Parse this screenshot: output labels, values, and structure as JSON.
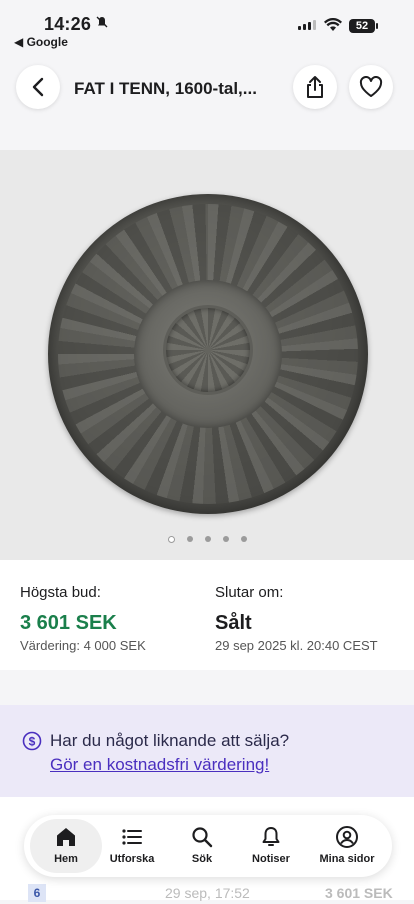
{
  "status_bar": {
    "time": "14:26",
    "back_app": "◀ Google",
    "battery": "52"
  },
  "header": {
    "title": "FAT I TENN, 1600-tal,..."
  },
  "gallery": {
    "image_count": 5,
    "active_index": 0
  },
  "bid": {
    "highest_bid_label": "Högsta bud:",
    "highest_bid_value": "3 601 SEK",
    "valuation": "Värdering: 4 000 SEK",
    "ends_label": "Slutar om:",
    "ends_value": "Sålt",
    "ends_date": "29 sep 2025 kl. 20:40 CEST"
  },
  "promo": {
    "question": "Har du något liknande att sälja?",
    "link": "Gör en kostnadsfri värdering!"
  },
  "bid_history_row": {
    "number": "6",
    "date": "29 sep, 17:52",
    "amount": "3 601 SEK"
  },
  "tabbar": {
    "items": [
      {
        "label": "Hem",
        "icon": "home-icon"
      },
      {
        "label": "Utforska",
        "icon": "list-icon"
      },
      {
        "label": "Sök",
        "icon": "search-icon"
      },
      {
        "label": "Notiser",
        "icon": "bell-icon"
      },
      {
        "label": "Mina sidor",
        "icon": "user-icon"
      }
    ]
  },
  "colors": {
    "price_green": "#1a7f4b",
    "promo_bg": "#ece9f8",
    "promo_link": "#4a2fbf"
  }
}
